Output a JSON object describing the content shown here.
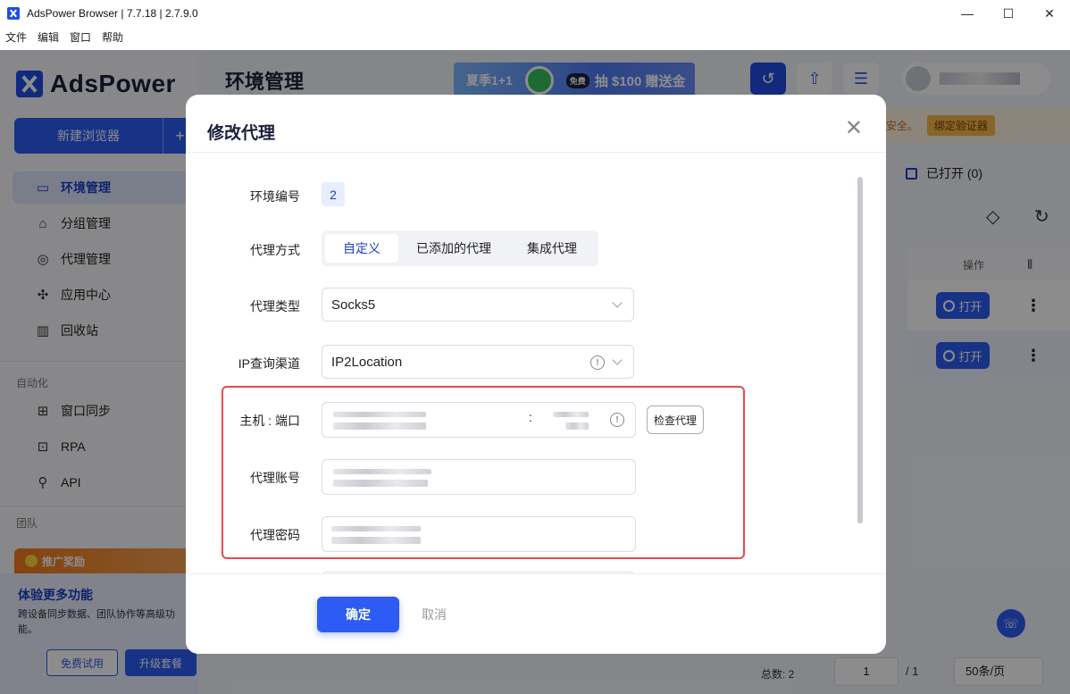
{
  "window": {
    "title": "AdsPower Browser | 7.7.18 | 2.7.9.0",
    "controls": [
      "—",
      "☐",
      "✕"
    ]
  },
  "menu": [
    "文件",
    "编辑",
    "窗口",
    "帮助"
  ],
  "sidebar": {
    "logo": "AdsPower",
    "new_browser": "新建浏览器",
    "nav": [
      {
        "label": "环境管理",
        "icon": "browser-window-icon"
      },
      {
        "label": "分组管理",
        "icon": "folder-icon"
      },
      {
        "label": "代理管理",
        "icon": "globe-icon"
      },
      {
        "label": "应用中心",
        "icon": "puzzle-icon"
      },
      {
        "label": "回收站",
        "icon": "trash-icon"
      }
    ],
    "section_automation": "自动化",
    "automation": [
      {
        "label": "窗口同步",
        "icon": "sync-windows-icon"
      },
      {
        "label": "RPA",
        "icon": "robot-icon"
      },
      {
        "label": "API",
        "icon": "plug-icon"
      }
    ],
    "section_team": "团队",
    "promo": {
      "header": "推广奖励",
      "title": "体验更多功能",
      "desc": "跨设备同步数据、团队协作等高级功能。",
      "free_trial": "免费试用",
      "upgrade": "升级套餐"
    }
  },
  "main": {
    "title": "环境管理",
    "banner": {
      "left": "夏季1+1",
      "tag": "免费",
      "right": "抽 $100 赠送金"
    },
    "warning": "安全。",
    "bind_btn": "绑定验证器",
    "opened": "已打开 (0)",
    "table": {
      "op_header": "操作",
      "open_label": "打开"
    },
    "footer": {
      "total": "总数: 2",
      "page": "1",
      "page_total": "/ 1",
      "page_size": "50条/页"
    }
  },
  "modal": {
    "title": "修改代理",
    "fields": {
      "env_id_label": "环境编号",
      "env_id": "2",
      "proxy_method_label": "代理方式",
      "proxy_methods": [
        "自定义",
        "已添加的代理",
        "集成代理"
      ],
      "proxy_method_selected": 0,
      "proxy_type_label": "代理类型",
      "proxy_type": "Socks5",
      "ip_channel_label": "IP查询渠道",
      "ip_channel": "IP2Location",
      "host_port_label": "主机 : 端口",
      "host_port_sep": ":",
      "check_proxy": "检查代理",
      "account_label": "代理账号",
      "password_label": "代理密码"
    },
    "ok": "确定",
    "cancel": "取消"
  },
  "colors": {
    "accent": "#2d5bf3",
    "highlight_border": "#e84b4b"
  }
}
